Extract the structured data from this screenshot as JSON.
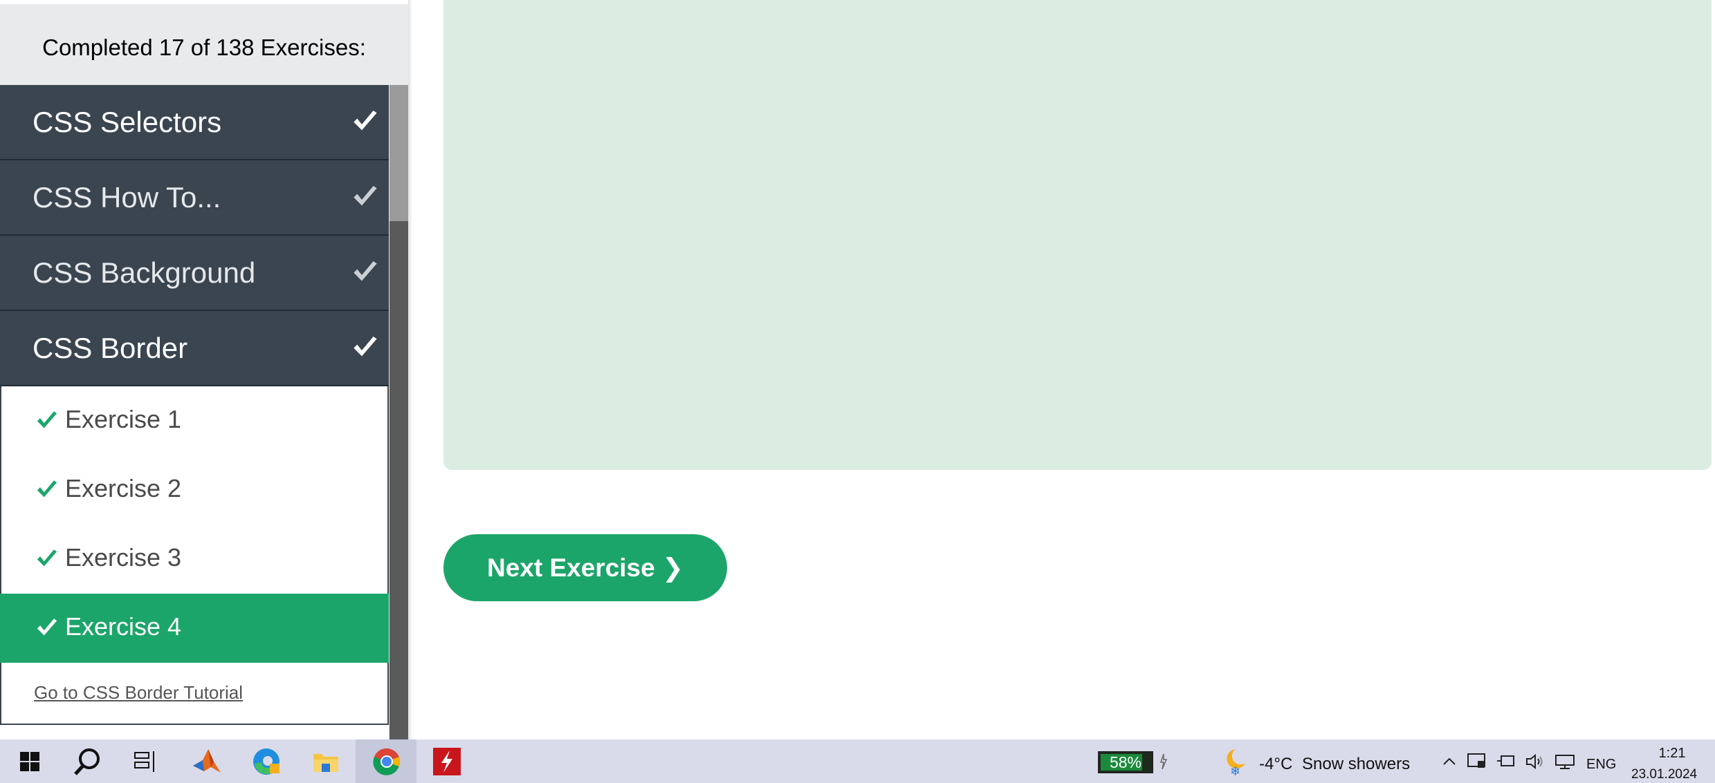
{
  "sidebar": {
    "progress_text": "Completed 17 of 138 Exercises:",
    "categories": [
      {
        "label": "CSS Selectors",
        "completed": true
      },
      {
        "label": "CSS How To...",
        "completed": true
      },
      {
        "label": "CSS Background",
        "completed": true
      },
      {
        "label": "CSS Border",
        "completed": true
      }
    ],
    "exercises": [
      {
        "label": "Exercise 1",
        "completed": true,
        "active": false
      },
      {
        "label": "Exercise 2",
        "completed": true,
        "active": false
      },
      {
        "label": "Exercise 3",
        "completed": true,
        "active": false
      },
      {
        "label": "Exercise 4",
        "completed": true,
        "active": true
      }
    ],
    "tutorial_link": "Go to CSS Border Tutorial"
  },
  "main": {
    "next_button": "Next Exercise ❯"
  },
  "taskbar": {
    "battery": "58%",
    "weather_temp": "-4°C",
    "weather_desc": "Snow showers",
    "language": "ENG",
    "time": "1:21",
    "date": "23.01.2024"
  },
  "colors": {
    "accent_green": "#1ca56a",
    "sidebar_dark": "#3a4550",
    "answer_bg": "#dbede2",
    "taskbar_bg": "#dadbea"
  }
}
